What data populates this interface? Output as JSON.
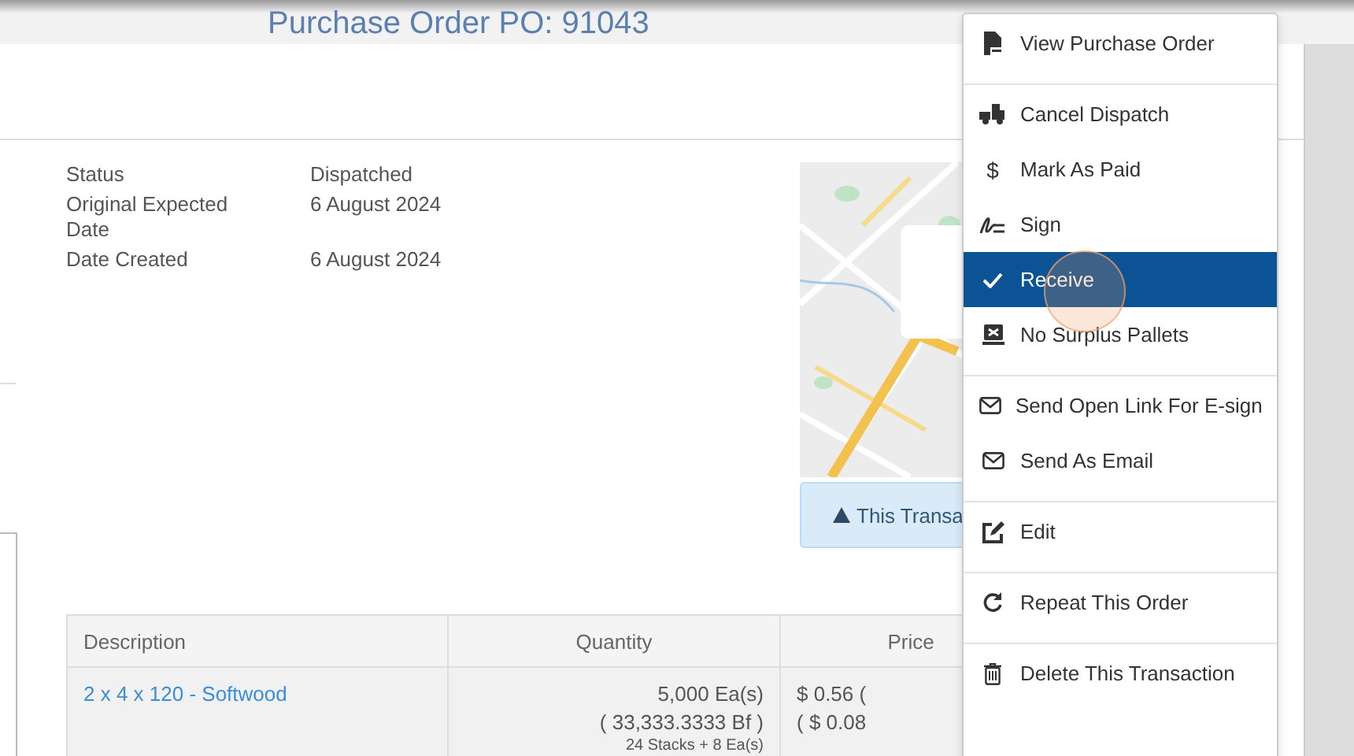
{
  "backdrop": {
    "title": "Purchase Order PO: 91043"
  },
  "details": [
    {
      "label": "Status",
      "value": "Dispatched"
    },
    {
      "label": "Original Expected Date",
      "value": "6 August 2024"
    },
    {
      "label": "Date Created",
      "value": "6 August 2024"
    }
  ],
  "alert": {
    "text": "This Transa"
  },
  "table": {
    "columns": [
      "Description",
      "Quantity",
      "Price"
    ],
    "rows": [
      {
        "description": "2 x 4 x 120 - Softwood",
        "quantity": [
          "5,000 Ea(s)",
          "( 33,333.3333 Bf )",
          "24 Stacks + 8 Ea(s)"
        ],
        "price": [
          "$ 0.56 (",
          "( $ 0.08"
        ]
      }
    ]
  },
  "menu": {
    "groups": [
      [
        {
          "label": "View Purchase Order",
          "kind": "pdf",
          "selected": false
        }
      ],
      [
        {
          "label": "Cancel Dispatch",
          "kind": "truck",
          "selected": false
        },
        {
          "label": "Mark As Paid",
          "kind": "dollar",
          "glyph": "$",
          "selected": false
        },
        {
          "label": "Sign",
          "kind": "signature",
          "selected": false
        },
        {
          "label": "Receive",
          "kind": "check",
          "selected": true
        },
        {
          "label": "No Surplus Pallets",
          "kind": "pallet",
          "selected": false
        }
      ],
      [
        {
          "label": "Send Open Link For E-sign",
          "kind": "mail",
          "selected": false
        },
        {
          "label": "Send As Email",
          "kind": "mail",
          "selected": false
        }
      ],
      [
        {
          "label": "Edit",
          "kind": "edit",
          "selected": false
        }
      ],
      [
        {
          "label": "Repeat This Order",
          "kind": "repeat",
          "selected": false
        }
      ],
      [
        {
          "label": "Delete This Transaction",
          "kind": "trash",
          "selected": false
        }
      ]
    ]
  }
}
